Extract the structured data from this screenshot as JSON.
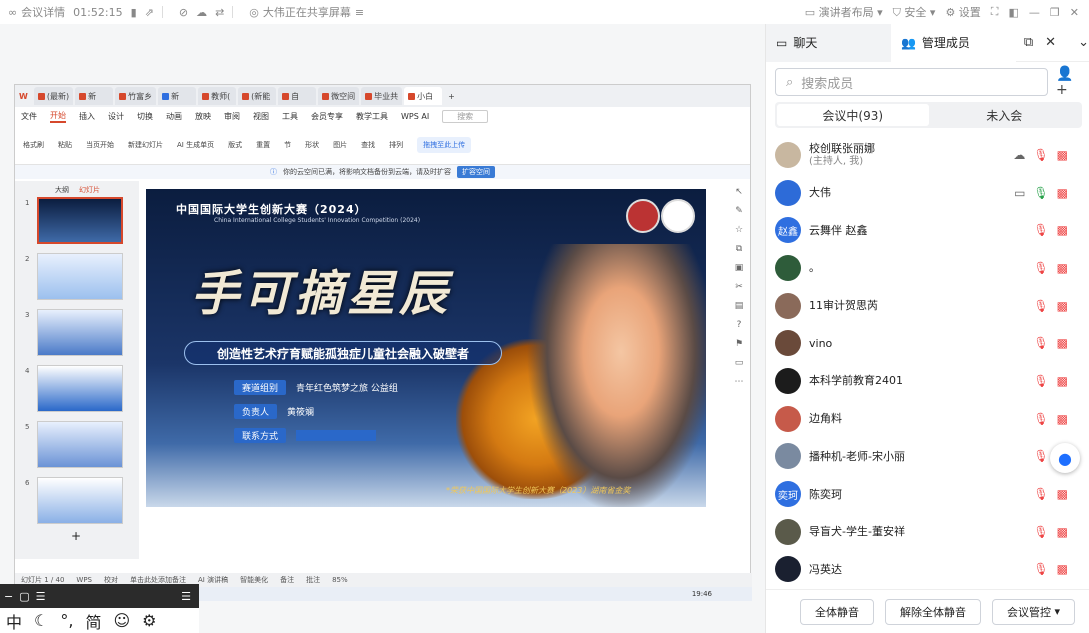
{
  "topbar": {
    "meeting_details": "会议详情",
    "time": "01:52:15",
    "sharing_status": "大伟正在共享屏幕",
    "speaker_layout": "演讲者布局",
    "security": "安全",
    "settings": "设置"
  },
  "wps": {
    "tabs": [
      "(最新)",
      "新",
      "竹富乡",
      "新",
      "教师(",
      "(新能",
      "自",
      "微空间",
      "毕业共",
      "小白"
    ],
    "menu": [
      "文件",
      "开始",
      "插入",
      "设计",
      "切换",
      "动画",
      "放映",
      "审阅",
      "视图",
      "工具",
      "会员专享",
      "教学工具",
      "WPS AI"
    ],
    "active_menu": "开始",
    "search_placeholder": "搜索",
    "ribbon": [
      "格式刷",
      "粘贴",
      "当页开始",
      "新建幻灯片",
      "AI 生成单页",
      "版式",
      "重置",
      "节",
      "形状",
      "图片",
      "查找",
      "排列"
    ],
    "infobar_text": "你的云空间已满，将影响文档备份到云端，请及时扩容",
    "infobar_button": "扩容空间",
    "upload_label": "拖拽至此上传",
    "outline_tab": "大纲",
    "slides_tab": "幻灯片",
    "slide_numbers": [
      "1",
      "2",
      "3",
      "4",
      "5",
      "6"
    ],
    "add_slide": "+",
    "notes_placeholder": "单击此处添加备注",
    "ai_notes": "AI 演讲稿",
    "status_left": "幻灯片 1 / 40",
    "status_wps": "WPS",
    "status_proof": "校对",
    "status_beautify": "智能美化",
    "status_comment": "备注",
    "status_annotate": "批注",
    "zoom": "85%",
    "taskbar_time": "19:46"
  },
  "slide": {
    "logo": "中国国际大学生创新大赛（2024）",
    "logo_sub": "China International College Students' Innovation Competition (2024)",
    "calligraphy": "手可摘星辰",
    "banner": "创造性艺术疗育赋能孤独症儿童社会融入破壁者",
    "rows": [
      {
        "k": "赛道组别",
        "v": "青年红色筑梦之旅   公益组"
      },
      {
        "k": "负责人",
        "v": "黄筱斓"
      },
      {
        "k": "联系方式",
        "v": ""
      }
    ],
    "footer": "*荣获中国国际大学生创新大赛（2023）湖南省金奖"
  },
  "ime": {
    "toolbar_chars": [
      "中",
      "简"
    ]
  },
  "panel": {
    "tab_chat": "聊天",
    "tab_members": "管理成员",
    "search_placeholder": "搜索成员",
    "seg_in": "会议中(93)",
    "seg_out": "未入会",
    "members": [
      {
        "name": "校创联张丽娜",
        "sub": "(主持人, 我)",
        "avatar": "",
        "color": "#c8b7a0"
      },
      {
        "name": "大伟",
        "sub": "",
        "avatar": "",
        "color": "#2d6bd8"
      },
      {
        "name": "云舞伴 赵鑫",
        "sub": "",
        "avatar": "赵鑫",
        "color": "#2f6fe0"
      },
      {
        "name": "。",
        "sub": "",
        "avatar": "",
        "color": "#2e5c3a"
      },
      {
        "name": "11审计贺思芮",
        "sub": "",
        "avatar": "",
        "color": "#8a6a5a"
      },
      {
        "name": "vino",
        "sub": "",
        "avatar": "",
        "color": "#6a4a3a"
      },
      {
        "name": "本科学前教育2401",
        "sub": "",
        "avatar": "",
        "color": "#1c1c1c"
      },
      {
        "name": "边角料",
        "sub": "",
        "avatar": "",
        "color": "#c65a4a"
      },
      {
        "name": "播种机-老师-宋小丽",
        "sub": "",
        "avatar": "",
        "color": "#7a8aa0"
      },
      {
        "name": "陈奕珂",
        "sub": "",
        "avatar": "奕珂",
        "color": "#2f6fe0"
      },
      {
        "name": "导盲犬-学生-董安祥",
        "sub": "",
        "avatar": "",
        "color": "#5a5a4a"
      },
      {
        "name": "冯英达",
        "sub": "",
        "avatar": "",
        "color": "#1a2030"
      }
    ],
    "btn_mute_all": "全体静音",
    "btn_unmute_all": "解除全体静音",
    "btn_control": "会议管控"
  }
}
